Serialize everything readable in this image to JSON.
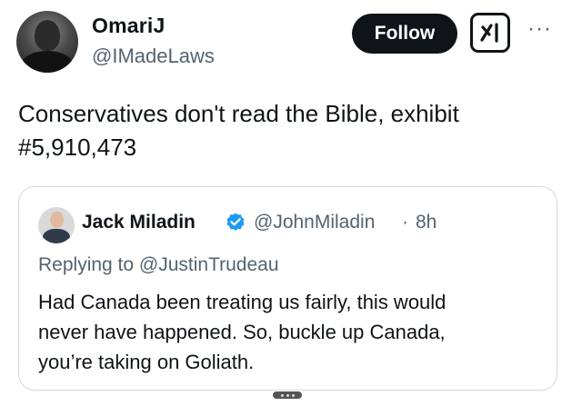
{
  "author": {
    "name": "OmariJ",
    "handle": "@IMadeLaws"
  },
  "actions": {
    "follow_label": "Follow",
    "more_label": "···",
    "grok_icon": "grok-icon"
  },
  "tweet": {
    "text": "Conservatives don't read the Bible, exhibit\n#5,910,473"
  },
  "quote": {
    "name": "Jack Miladin",
    "verified_icon": "verified-badge-icon",
    "verified_color": "#1d9bf0",
    "handle": "@JohnMiladin",
    "separator": "·",
    "time": "8h",
    "replying_prefix": "Replying to",
    "replying_to": "@JustinTrudeau",
    "text": "Had Canada been treating us fairly, this would\nnever have happened. So, buckle up Canada,\nyou’re taking on Goliath."
  }
}
